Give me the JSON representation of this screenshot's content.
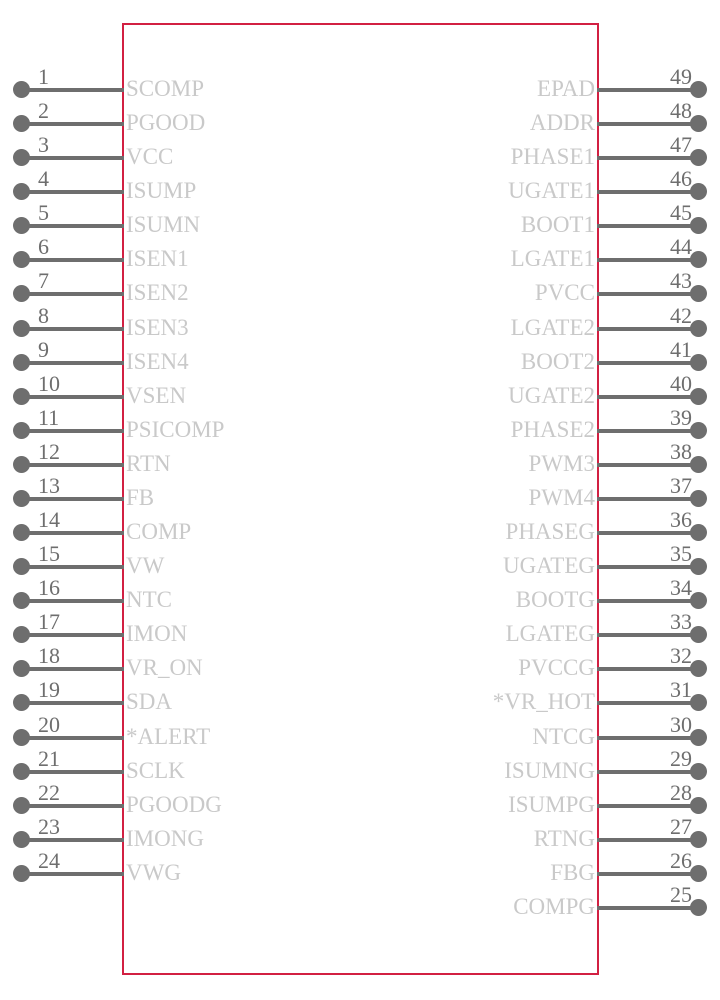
{
  "symbol": {
    "kind": "ic-pinout-symbol",
    "package_pin_count": 49,
    "body_border_color": "#d22042",
    "pin_color": "#6e6e6e",
    "label_color": "#c9c9c9",
    "background_color": "#ffffff"
  },
  "left_pins": [
    {
      "number": "1",
      "label": "SCOMP"
    },
    {
      "number": "2",
      "label": "PGOOD"
    },
    {
      "number": "3",
      "label": "VCC"
    },
    {
      "number": "4",
      "label": "ISUMP"
    },
    {
      "number": "5",
      "label": "ISUMN"
    },
    {
      "number": "6",
      "label": "ISEN1"
    },
    {
      "number": "7",
      "label": "ISEN2"
    },
    {
      "number": "8",
      "label": "ISEN3"
    },
    {
      "number": "9",
      "label": "ISEN4"
    },
    {
      "number": "10",
      "label": "VSEN"
    },
    {
      "number": "11",
      "label": "PSICOMP"
    },
    {
      "number": "12",
      "label": "RTN"
    },
    {
      "number": "13",
      "label": "FB"
    },
    {
      "number": "14",
      "label": "COMP"
    },
    {
      "number": "15",
      "label": "VW"
    },
    {
      "number": "16",
      "label": "NTC"
    },
    {
      "number": "17",
      "label": "IMON"
    },
    {
      "number": "18",
      "label": "VR_ON"
    },
    {
      "number": "19",
      "label": "SDA"
    },
    {
      "number": "20",
      "label": "*ALERT"
    },
    {
      "number": "21",
      "label": "SCLK"
    },
    {
      "number": "22",
      "label": "PGOODG"
    },
    {
      "number": "23",
      "label": "IMONG"
    },
    {
      "number": "24",
      "label": "VWG"
    }
  ],
  "right_pins": [
    {
      "number": "49",
      "label": "EPAD"
    },
    {
      "number": "48",
      "label": "ADDR"
    },
    {
      "number": "47",
      "label": "PHASE1"
    },
    {
      "number": "46",
      "label": "UGATE1"
    },
    {
      "number": "45",
      "label": "BOOT1"
    },
    {
      "number": "44",
      "label": "LGATE1"
    },
    {
      "number": "43",
      "label": "PVCC"
    },
    {
      "number": "42",
      "label": "LGATE2"
    },
    {
      "number": "41",
      "label": "BOOT2"
    },
    {
      "number": "40",
      "label": "UGATE2"
    },
    {
      "number": "39",
      "label": "PHASE2"
    },
    {
      "number": "38",
      "label": "PWM3"
    },
    {
      "number": "37",
      "label": "PWM4"
    },
    {
      "number": "36",
      "label": "PHASEG"
    },
    {
      "number": "35",
      "label": "UGATEG"
    },
    {
      "number": "34",
      "label": "BOOTG"
    },
    {
      "number": "33",
      "label": "LGATEG"
    },
    {
      "number": "32",
      "label": "PVCCG"
    },
    {
      "number": "31",
      "label": "*VR_HOT"
    },
    {
      "number": "30",
      "label": "NTCG"
    },
    {
      "number": "29",
      "label": "ISUMNG"
    },
    {
      "number": "28",
      "label": "ISUMPG"
    },
    {
      "number": "27",
      "label": "RTNG"
    },
    {
      "number": "26",
      "label": "FBG"
    },
    {
      "number": "25",
      "label": "COMPG"
    }
  ]
}
